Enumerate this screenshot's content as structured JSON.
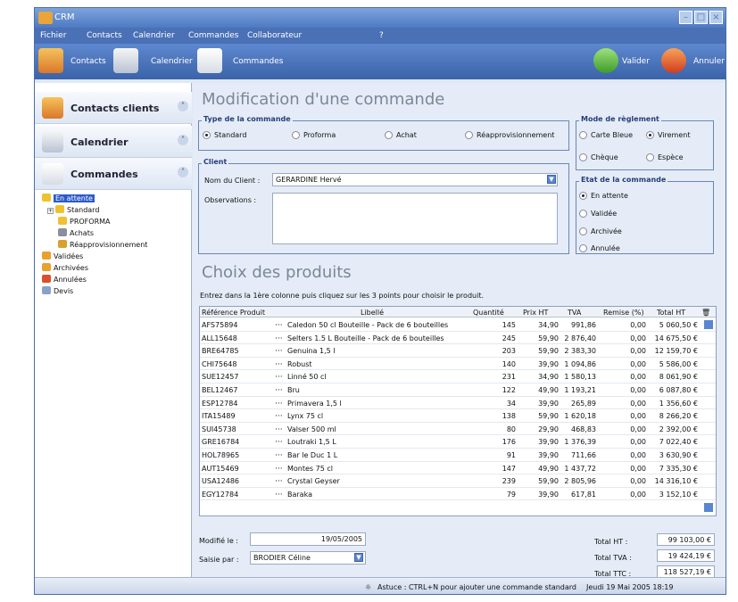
{
  "window": {
    "title": "CRM"
  },
  "menu": [
    "Fichier",
    "Contacts",
    "Calendrier",
    "Commandes",
    "Collaborateur",
    "?"
  ],
  "toolbar": {
    "contacts": "Contacts",
    "calendrier": "Calendrier",
    "commandes": "Commandes",
    "valider": "Valider",
    "annuler": "Annuler"
  },
  "sidebar": {
    "sections": [
      "Contacts clients",
      "Calendrier",
      "Commandes"
    ],
    "tree": {
      "en_attente": "En attente",
      "standard": "Standard",
      "proforma": "PROFORMA",
      "achats": "Achats",
      "reappro": "Réapprovisionnement",
      "validees": "Validées",
      "archivees": "Archivées",
      "annulees": "Annulées",
      "devis": "Devis"
    }
  },
  "form": {
    "title": "Modification d'une commande",
    "type": {
      "legend": "Type de la commande",
      "options": [
        "Standard",
        "Proforma",
        "Achat",
        "Réapprovisionnement"
      ],
      "selected": "Standard"
    },
    "reglement": {
      "legend": "Mode de règlement",
      "options": [
        "Carte Bleue",
        "Virement",
        "Chèque",
        "Espèce"
      ],
      "selected": "Virement"
    },
    "client": {
      "legend": "Client",
      "nom_label": "Nom du Client :",
      "nom_value": "GERARDINE Hervé",
      "obs_label": "Observations :",
      "obs_value": ""
    },
    "etat": {
      "legend": "Etat de la commande",
      "options": [
        "En attente",
        "Validée",
        "Archivée",
        "Annulée"
      ],
      "selected": "En attente"
    }
  },
  "products": {
    "title": "Choix des produits",
    "hint": "Entrez dans la 1ère colonne puis cliquez sur les 3 points pour choisir le produit.",
    "columns": [
      "Référence Produit",
      "Libellé",
      "Quantité",
      "Prix HT",
      "TVA",
      "Remise (%)",
      "Total HT"
    ],
    "rows": [
      [
        "AFS75894",
        "Caledon 50 cl Bouteille - Pack de 6 bouteilles",
        "145",
        "34,90",
        "991,86",
        "0,00",
        "5 060,50 €"
      ],
      [
        "ALL15648",
        "Selters 1.5 L Bouteille - Pack de 6 bouteilles",
        "245",
        "59,90",
        "2 876,40",
        "0,00",
        "14 675,50 €"
      ],
      [
        "BRE64785",
        "Genuina 1,5 l",
        "203",
        "59,90",
        "2 383,30",
        "0,00",
        "12 159,70 €"
      ],
      [
        "CHI75648",
        "Robust",
        "140",
        "39,90",
        "1 094,86",
        "0,00",
        "5 586,00 €"
      ],
      [
        "SUE12457",
        "Linné 50 cl",
        "231",
        "34,90",
        "1 580,13",
        "0,00",
        "8 061,90 €"
      ],
      [
        "BEL12467",
        "Bru",
        "122",
        "49,90",
        "1 193,21",
        "0,00",
        "6 087,80 €"
      ],
      [
        "ESP12784",
        "Primavera 1,5 l",
        "34",
        "39,90",
        "265,89",
        "0,00",
        "1 356,60 €"
      ],
      [
        "ITA15489",
        "Lynx 75 cl",
        "138",
        "59,90",
        "1 620,18",
        "0,00",
        "8 266,20 €"
      ],
      [
        "SUI45738",
        "Valser 500 ml",
        "80",
        "29,90",
        "468,83",
        "0,00",
        "2 392,00 €"
      ],
      [
        "GRE16784",
        "Loutraki 1,5 L",
        "176",
        "39,90",
        "1 376,39",
        "0,00",
        "7 022,40 €"
      ],
      [
        "HOL78965",
        "Bar le Duc 1 L",
        "91",
        "39,90",
        "711,66",
        "0,00",
        "3 630,90 €"
      ],
      [
        "AUT15469",
        "Montes 75 cl",
        "147",
        "49,90",
        "1 437,72",
        "0,00",
        "7 335,30 €"
      ],
      [
        "USA12486",
        "Crystal Geyser",
        "239",
        "59,90",
        "2 805,96",
        "0,00",
        "14 316,10 €"
      ],
      [
        "EGY12784",
        "Baraka",
        "79",
        "39,90",
        "617,81",
        "0,00",
        "3 152,10 €"
      ]
    ]
  },
  "footer": {
    "modifie_label": "Modifié le :",
    "modifie_value": "19/05/2005",
    "saisie_label": "Saisie par :",
    "saisie_value": "BRODIER Céline",
    "total_ht_label": "Total HT :",
    "total_ht": "99 103,00 €",
    "total_tva_label": "Total TVA :",
    "total_tva": "19 424,19 €",
    "total_ttc_label": "Total TTC :",
    "total_ttc": "118 527,19 €"
  },
  "status": {
    "tip": "Astuce : CTRL+N pour ajouter une commande standard",
    "datetime": "Jeudi 19 Mai 2005 18:19"
  }
}
